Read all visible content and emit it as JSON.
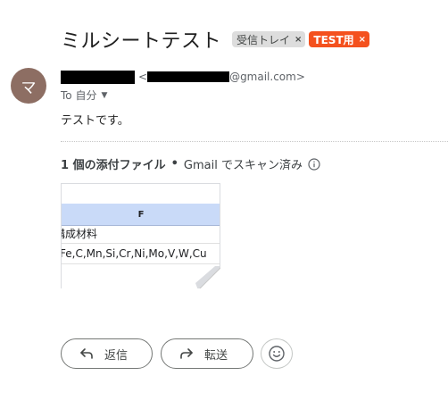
{
  "subject": "ミルシートテスト",
  "labels": [
    {
      "text": "受信トレイ",
      "remove": "×"
    },
    {
      "text": "TEST用",
      "remove": "×"
    }
  ],
  "sender": {
    "avatar_letter": "マ",
    "email_open": "<",
    "email_domain": "@gmail.com>",
    "to_label": "To 自分"
  },
  "message_body": "テストです。",
  "attachments": {
    "count_label": "1 個の添付ファイル",
    "separator": "•",
    "scan_label": "Gmail でスキャン済み",
    "preview": {
      "column_header": "F",
      "cell1": "構成材料",
      "cell2": "Fe,C,Mn,Si,Cr,Ni,Mo,V,W,Cu"
    }
  },
  "actions": {
    "reply_label": "返信",
    "forward_label": "転送"
  },
  "icons": {
    "reply": "reply-icon",
    "forward": "forward-icon",
    "emoji": "emoji-icon",
    "info": "info-icon",
    "dropdown": "chevron-down-icon"
  },
  "colors": {
    "avatar_bg": "#8d6e63",
    "test_label_bg": "#f4511e",
    "inbox_label_bg": "#dddddd",
    "sheet_header_bg": "#c9daf8"
  }
}
